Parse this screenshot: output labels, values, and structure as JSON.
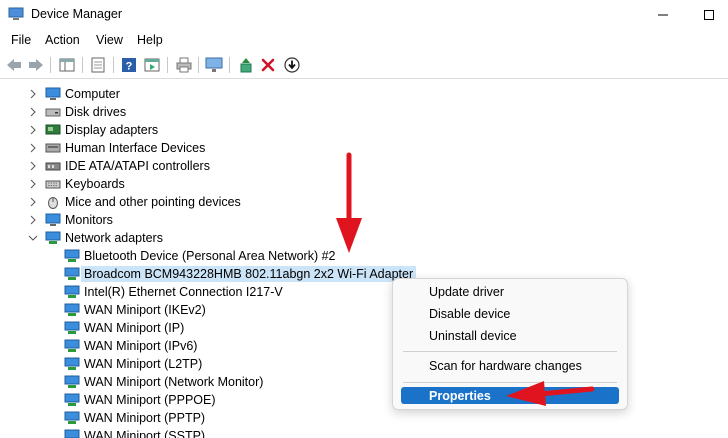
{
  "window": {
    "title": "Device Manager",
    "icon": "device-manager-icon"
  },
  "menu": [
    "File",
    "Action",
    "View",
    "Help"
  ],
  "tree": {
    "categories": [
      {
        "label": "Computer",
        "icon": "computer-icon"
      },
      {
        "label": "Disk drives",
        "icon": "disk-drive-icon"
      },
      {
        "label": "Display adapters",
        "icon": "display-adapter-icon"
      },
      {
        "label": "Human Interface Devices",
        "icon": "hid-icon"
      },
      {
        "label": "IDE ATA/ATAPI controllers",
        "icon": "ide-controller-icon"
      },
      {
        "label": "Keyboards",
        "icon": "keyboard-icon"
      },
      {
        "label": "Mice and other pointing devices",
        "icon": "mouse-icon"
      },
      {
        "label": "Monitors",
        "icon": "monitor-icon"
      },
      {
        "label": "Network adapters",
        "icon": "network-adapter-icon",
        "expanded": true
      }
    ],
    "network_children": [
      "Bluetooth Device (Personal Area Network) #2",
      "Broadcom BCM943228HMB 802.11abgn 2x2 Wi-Fi Adapter",
      "Intel(R) Ethernet Connection I217-V",
      "WAN Miniport (IKEv2)",
      "WAN Miniport (IP)",
      "WAN Miniport (IPv6)",
      "WAN Miniport (L2TP)",
      "WAN Miniport (Network Monitor)",
      "WAN Miniport (PPPOE)",
      "WAN Miniport (PPTP)",
      "WAN Miniport (SSTP)"
    ],
    "selected_child": "Broadcom BCM943228HMB 802.11abgn 2x2 Wi-Fi Adapter"
  },
  "context_menu": {
    "items": [
      "Update driver",
      "Disable device",
      "Uninstall device",
      "Scan for hardware changes",
      "Properties"
    ],
    "highlighted": "Properties"
  },
  "colors": {
    "selection": "#cce4f7",
    "highlight": "#1a73c9",
    "arrow": "#e0141e"
  }
}
